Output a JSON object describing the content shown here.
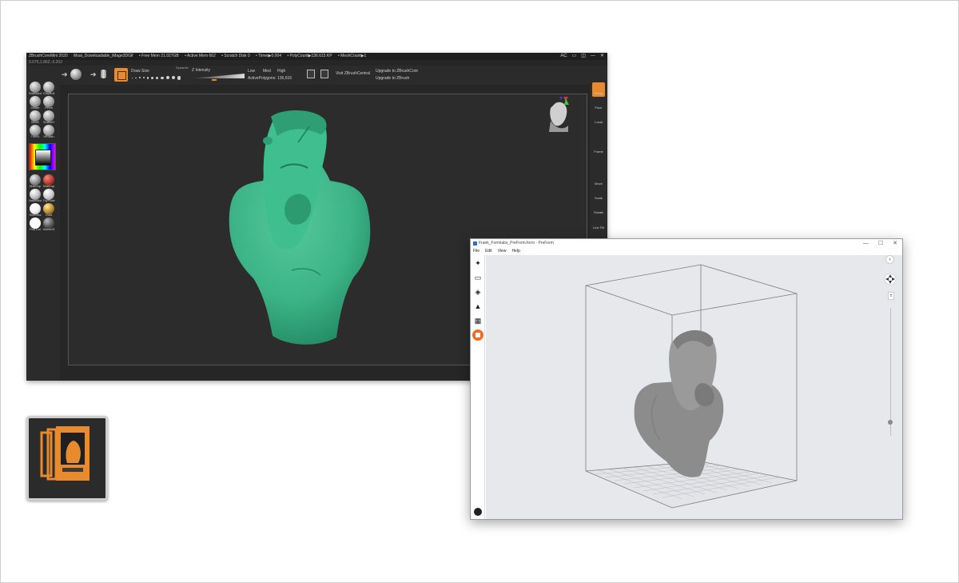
{
  "zbrush": {
    "titlebar": {
      "app": "ZBrushCoreMini 2020",
      "file": "Moai_Downloadable_iMage3DGlf",
      "free_mem": "• Free Mem 21.027GB",
      "active_mem": "• Active Mem 662",
      "scratch_disk": "• Scratch Disk 0",
      "timer": "• Timer▶0.004",
      "poly_count": "• PolyCount▶136.615 KP",
      "mesh_count": "• MeshCount▶1"
    },
    "window_controls": [
      "AC",
      "▭",
      "◫",
      "—",
      "✕"
    ],
    "coords": "0.075,1.862,-0.202",
    "toolbar": {
      "draw_size_label": "Draw Size",
      "dynamic_label": "Dynamic",
      "z_intensity_label": "Z Intensity",
      "low": "Low",
      "med": "Med",
      "high": "High",
      "active_polygons": "ActivePolygons: 136,616",
      "visit_central": "Visit ZBrushCentral",
      "upgrade_core": "Upgrade to ZBrushCore",
      "upgrade_zbrush": "Upgrade to ZBrush"
    },
    "brushes": [
      {
        "label": "Standard"
      },
      {
        "label": "ClayBuil"
      },
      {
        "label": "Inflate"
      },
      {
        "label": "Pinch"
      },
      {
        "label": "Move"
      },
      {
        "label": "SnakeH"
      },
      {
        "label": "TrimD"
      },
      {
        "label": "hPolish"
      }
    ],
    "materials": [
      {
        "label": "MatCap",
        "color": "#b0b0b0"
      },
      {
        "label": "MatCap",
        "color": "#b33a2a"
      },
      {
        "label": "BasicMa",
        "color": "#d8d8d8"
      },
      {
        "label": "ToyPlast",
        "color": "#c9c9c9"
      },
      {
        "label": "SkinSha",
        "color": "#f2f2f2"
      },
      {
        "label": "Gold",
        "color": "#b98a2a"
      },
      {
        "label": "Flat Col",
        "color": "#ffffff"
      },
      {
        "label": "SketchS",
        "color": "#6a6a6a"
      }
    ],
    "right_shelf": [
      "Persp",
      "Floor",
      "Local",
      "Frame",
      "Move",
      "Scale",
      "Rotate",
      "Line Fill"
    ],
    "model_color": "#3cb488"
  },
  "preform": {
    "title": "Frank_Formlabs_PreForm.form - PreForm",
    "window_controls": [
      "—",
      "☐",
      "✕"
    ],
    "menu": [
      "File",
      "Edit",
      "View",
      "Help"
    ],
    "accent": "#f26b21",
    "model_color": "#8c8c8c"
  },
  "icon_tile": {
    "accent": "#e88a2e"
  }
}
